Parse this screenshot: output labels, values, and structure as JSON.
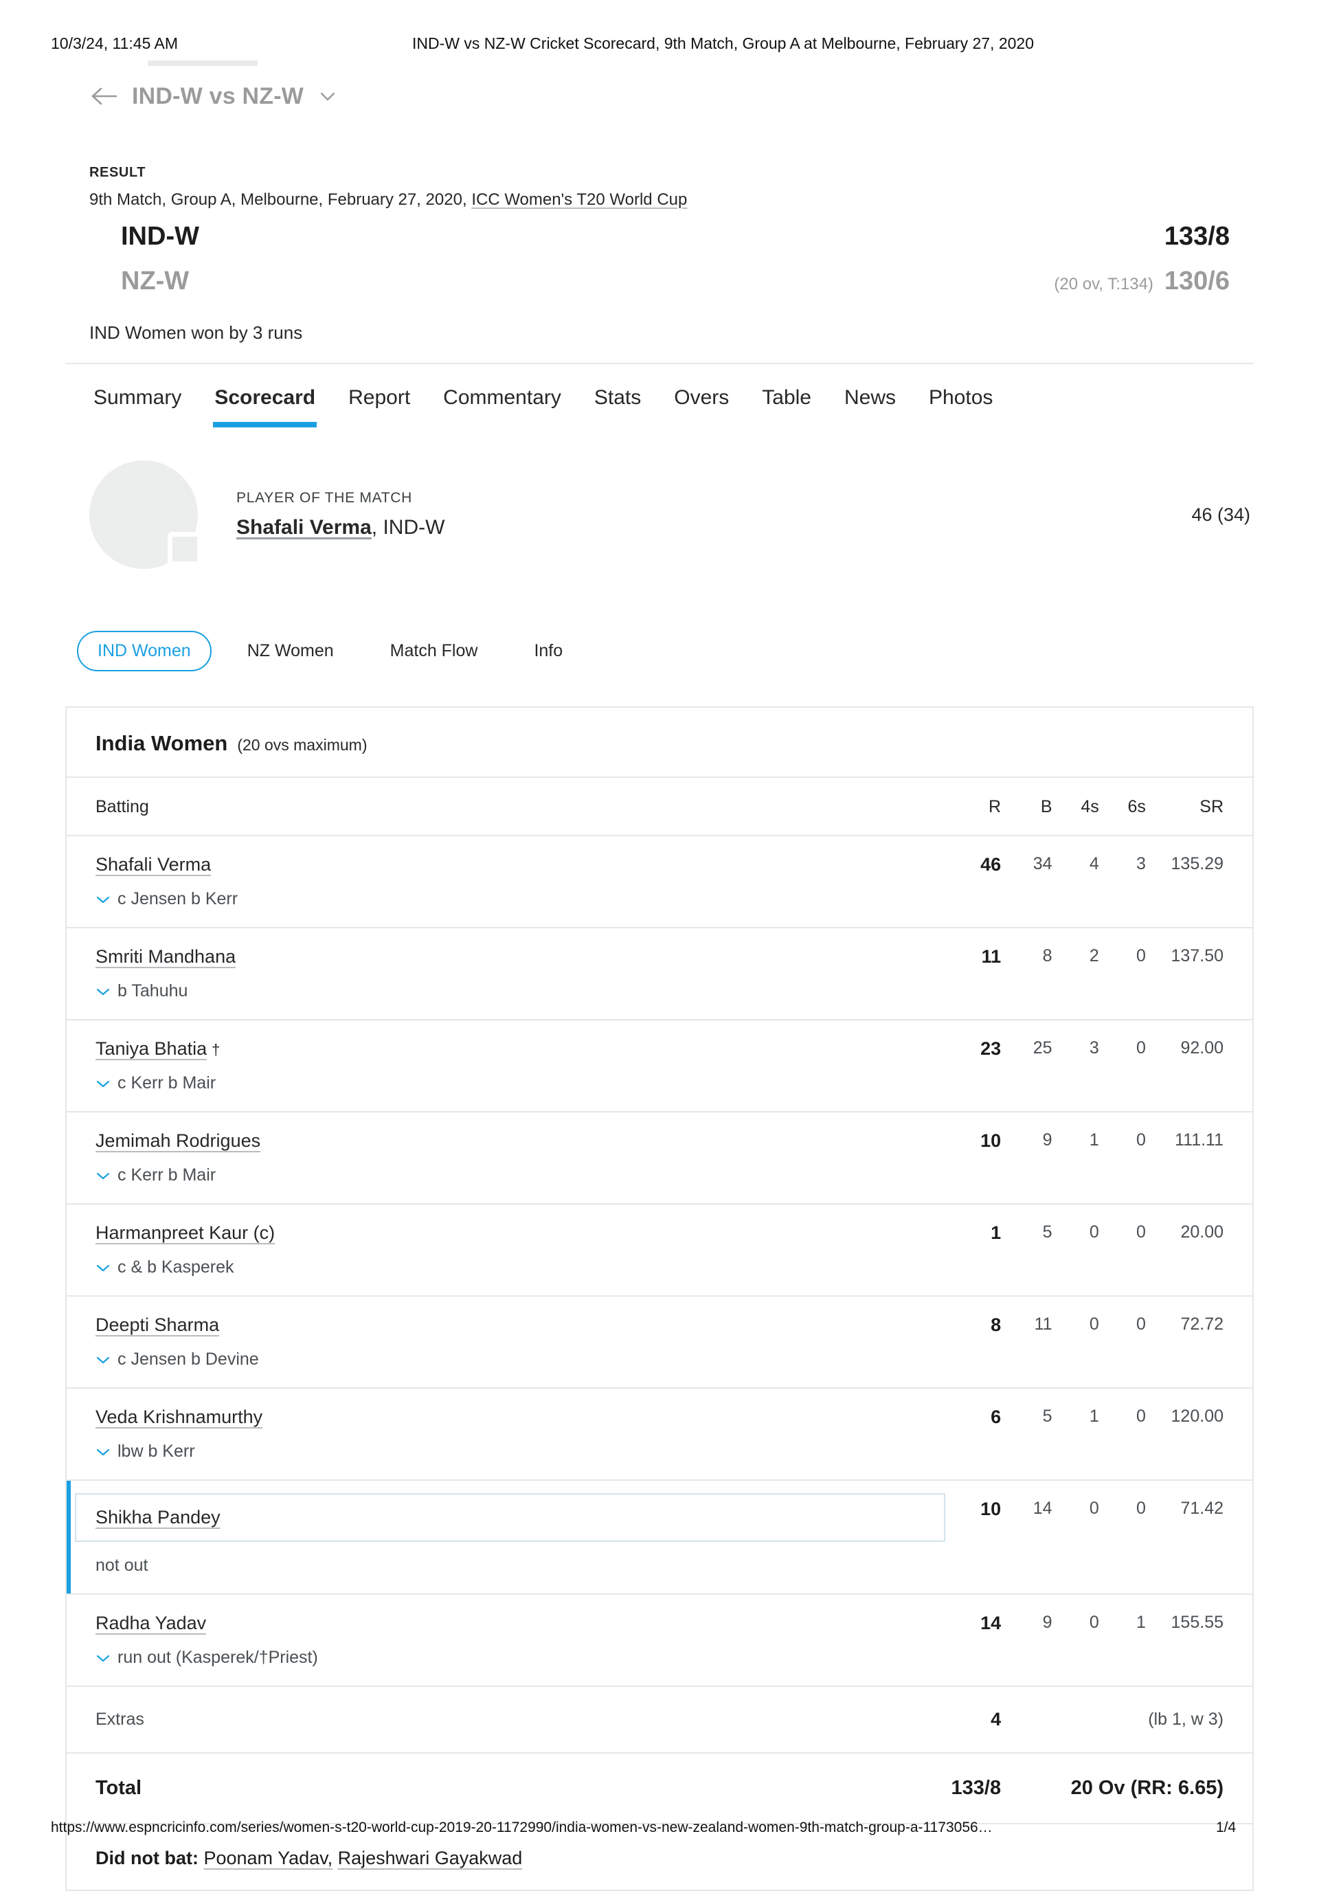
{
  "print_header": {
    "timestamp": "10/3/24, 11:45 AM",
    "doc_title": "IND-W vs NZ-W Cricket Scorecard, 9th Match, Group A at Melbourne, February 27, 2020"
  },
  "navbar": {
    "title": "IND-W vs NZ-W",
    "back_icon": "back-arrow-icon",
    "chevron_icon": "chevron-down-icon"
  },
  "result": {
    "label": "RESULT",
    "meta_prefix": "9th Match, Group A, Melbourne, February 27, 2020, ",
    "series_link": "ICC Women's T20 World Cup",
    "teams": [
      {
        "name": "IND-W",
        "overs": "",
        "score": "133/8"
      },
      {
        "name": "NZ-W",
        "overs": "(20 ov, T:134)",
        "score": "130/6"
      }
    ],
    "outcome": "IND Women won by 3 runs"
  },
  "tabs": [
    {
      "label": "Summary",
      "active": false
    },
    {
      "label": "Scorecard",
      "active": true
    },
    {
      "label": "Report",
      "active": false
    },
    {
      "label": "Commentary",
      "active": false
    },
    {
      "label": "Stats",
      "active": false
    },
    {
      "label": "Overs",
      "active": false
    },
    {
      "label": "Table",
      "active": false
    },
    {
      "label": "News",
      "active": false
    },
    {
      "label": "Photos",
      "active": false
    }
  ],
  "player_of_match": {
    "label": "PLAYER OF THE MATCH",
    "name": "Shafali Verma",
    "team_suffix": ", IND-W",
    "figure": "46 (34)"
  },
  "pills": [
    {
      "label": "IND Women",
      "active": true
    },
    {
      "label": "NZ Women",
      "active": false
    },
    {
      "label": "Match Flow",
      "active": false
    },
    {
      "label": "Info",
      "active": false
    }
  ],
  "scorecard": {
    "innings_title": "India Women",
    "innings_sub": "(20 ovs maximum)",
    "columns": [
      "Batting",
      "R",
      "B",
      "4s",
      "6s",
      "SR"
    ],
    "batters": [
      {
        "name": "Shafali Verma",
        "mark": "",
        "dismissal": "c Jensen b Kerr",
        "has_chevron": true,
        "focused": false,
        "r": "46",
        "b": "34",
        "fours": "4",
        "sixes": "3",
        "sr": "135.29"
      },
      {
        "name": "Smriti Mandhana",
        "mark": "",
        "dismissal": "b Tahuhu",
        "has_chevron": true,
        "focused": false,
        "r": "11",
        "b": "8",
        "fours": "2",
        "sixes": "0",
        "sr": "137.50"
      },
      {
        "name": "Taniya Bhatia",
        "mark": "†",
        "dismissal": "c Kerr b Mair",
        "has_chevron": true,
        "focused": false,
        "r": "23",
        "b": "25",
        "fours": "3",
        "sixes": "0",
        "sr": "92.00"
      },
      {
        "name": "Jemimah Rodrigues",
        "mark": "",
        "dismissal": "c Kerr b Mair",
        "has_chevron": true,
        "focused": false,
        "r": "10",
        "b": "9",
        "fours": "1",
        "sixes": "0",
        "sr": "111.11"
      },
      {
        "name": "Harmanpreet Kaur (c)",
        "mark": "",
        "dismissal": "c & b Kasperek",
        "has_chevron": true,
        "focused": false,
        "r": "1",
        "b": "5",
        "fours": "0",
        "sixes": "0",
        "sr": "20.00"
      },
      {
        "name": "Deepti Sharma",
        "mark": "",
        "dismissal": "c Jensen b Devine",
        "has_chevron": true,
        "focused": false,
        "r": "8",
        "b": "11",
        "fours": "0",
        "sixes": "0",
        "sr": "72.72"
      },
      {
        "name": "Veda Krishnamurthy",
        "mark": "",
        "dismissal": "lbw b Kerr",
        "has_chevron": true,
        "focused": false,
        "r": "6",
        "b": "5",
        "fours": "1",
        "sixes": "0",
        "sr": "120.00"
      },
      {
        "name": "Shikha Pandey",
        "mark": "",
        "dismissal": "not out",
        "has_chevron": false,
        "focused": true,
        "r": "10",
        "b": "14",
        "fours": "0",
        "sixes": "0",
        "sr": "71.42"
      },
      {
        "name": "Radha Yadav",
        "mark": "",
        "dismissal": "run out (Kasperek/†Priest)",
        "has_chevron": true,
        "focused": false,
        "r": "14",
        "b": "9",
        "fours": "0",
        "sixes": "1",
        "sr": "155.55"
      }
    ],
    "extras": {
      "label": "Extras",
      "value": "4",
      "note": "(lb 1, w 3)"
    },
    "total": {
      "label": "Total",
      "value": "133/8",
      "note": "20 Ov (RR: 6.65)"
    },
    "did_not_bat": {
      "label": "Did not bat:",
      "players": [
        "Poonam Yadav,",
        "Rajeshwari Gayakwad"
      ]
    }
  },
  "footer": {
    "url": "https://www.espncricinfo.com/series/women-s-t20-world-cup-2019-20-1172990/india-women-vs-new-zealand-women-9th-match-group-a-1173056…",
    "page": "1/4"
  },
  "colors": {
    "accent": "#1ba0e2",
    "muted": "#9b9b9b",
    "border": "#e6e7e9",
    "text": "#26282a"
  }
}
